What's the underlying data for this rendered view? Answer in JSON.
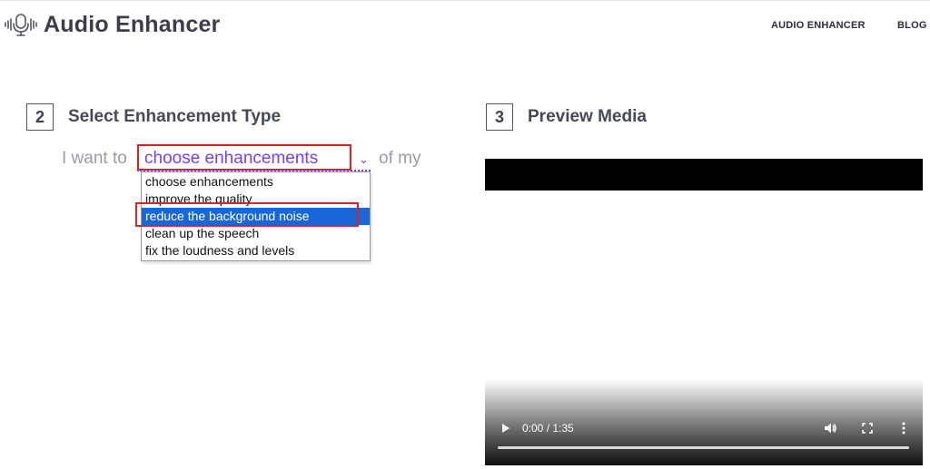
{
  "header": {
    "logo_text": "Audio Enhancer",
    "logo_icon": "microphone-icon",
    "nav": [
      "AUDIO ENHANCER",
      "BLOG"
    ]
  },
  "step2": {
    "number": "2",
    "title": "Select Enhancement Type",
    "sentence_prefix": "I want to",
    "sentence_suffix": "of my",
    "selected": "choose enhancements",
    "options": [
      "choose enhancements",
      "improve the quality",
      "reduce the background noise",
      "clean up the speech",
      "fix the loudness and levels"
    ],
    "highlighted_index": 2
  },
  "step3": {
    "number": "3",
    "title": "Preview Media"
  },
  "player": {
    "time": "0:00 / 1:35",
    "progress": 0
  },
  "colors": {
    "accent": "#7a3ff0",
    "highlight": "#1a66d9",
    "annotation": "#e02020"
  }
}
